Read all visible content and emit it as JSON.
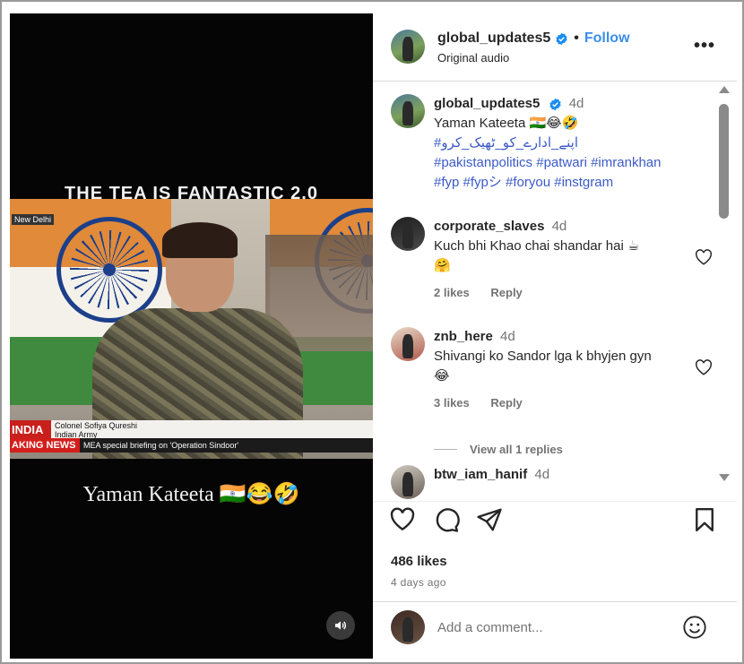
{
  "video": {
    "headline": "THE TEA IS FANTASTIC 2.0",
    "city_tag": "New Delhi",
    "lower_third": {
      "red_label": "INDIA",
      "name": "Colonel Sofiya Qureshi",
      "rank": "Indian Army",
      "breaking": "AKING NEWS",
      "ticker": "MEA special briefing on 'Operation Sindoor'"
    },
    "caption": "Yaman Kateeta 🇮🇳😂🤣"
  },
  "header": {
    "username": "global_updates5",
    "separator": "•",
    "follow_label": "Follow",
    "subtitle": "Original audio",
    "more_label": "•••"
  },
  "post": {
    "username": "global_updates5",
    "time": "4d",
    "caption_line1": "Yaman Kateeta 🇮🇳😂🤣",
    "hashtags_line1": "#اپنے_ادارے_کو_ٹھیک_کرو",
    "hashtags_line2": "#pakistanpolitics #patwari #imrankhan",
    "hashtags_line3": "#fyp #fypシ #foryou #instgram"
  },
  "comments": [
    {
      "username": "corporate_slaves",
      "time": "4d",
      "text": "Kuch bhi Khao chai shandar hai ☕ 🤗",
      "likes": "2 likes",
      "reply": "Reply"
    },
    {
      "username": "znb_here",
      "time": "4d",
      "text": "Shivangi ko Sandor lga k bhyjen gyn😂",
      "likes": "3 likes",
      "reply": "Reply"
    },
    {
      "username": "btw_iam_hanif",
      "time": "4d"
    }
  ],
  "view_replies": "View all 1 replies",
  "actions": {
    "likes": "486 likes",
    "posted_ago": "4 days ago"
  },
  "add_comment": {
    "placeholder": "Add a comment..."
  },
  "colors": {
    "link_blue": "#3b5bc7",
    "follow_blue": "#3a8ee8",
    "verified_blue": "#1c8cf0",
    "muted_gray": "#737373"
  }
}
